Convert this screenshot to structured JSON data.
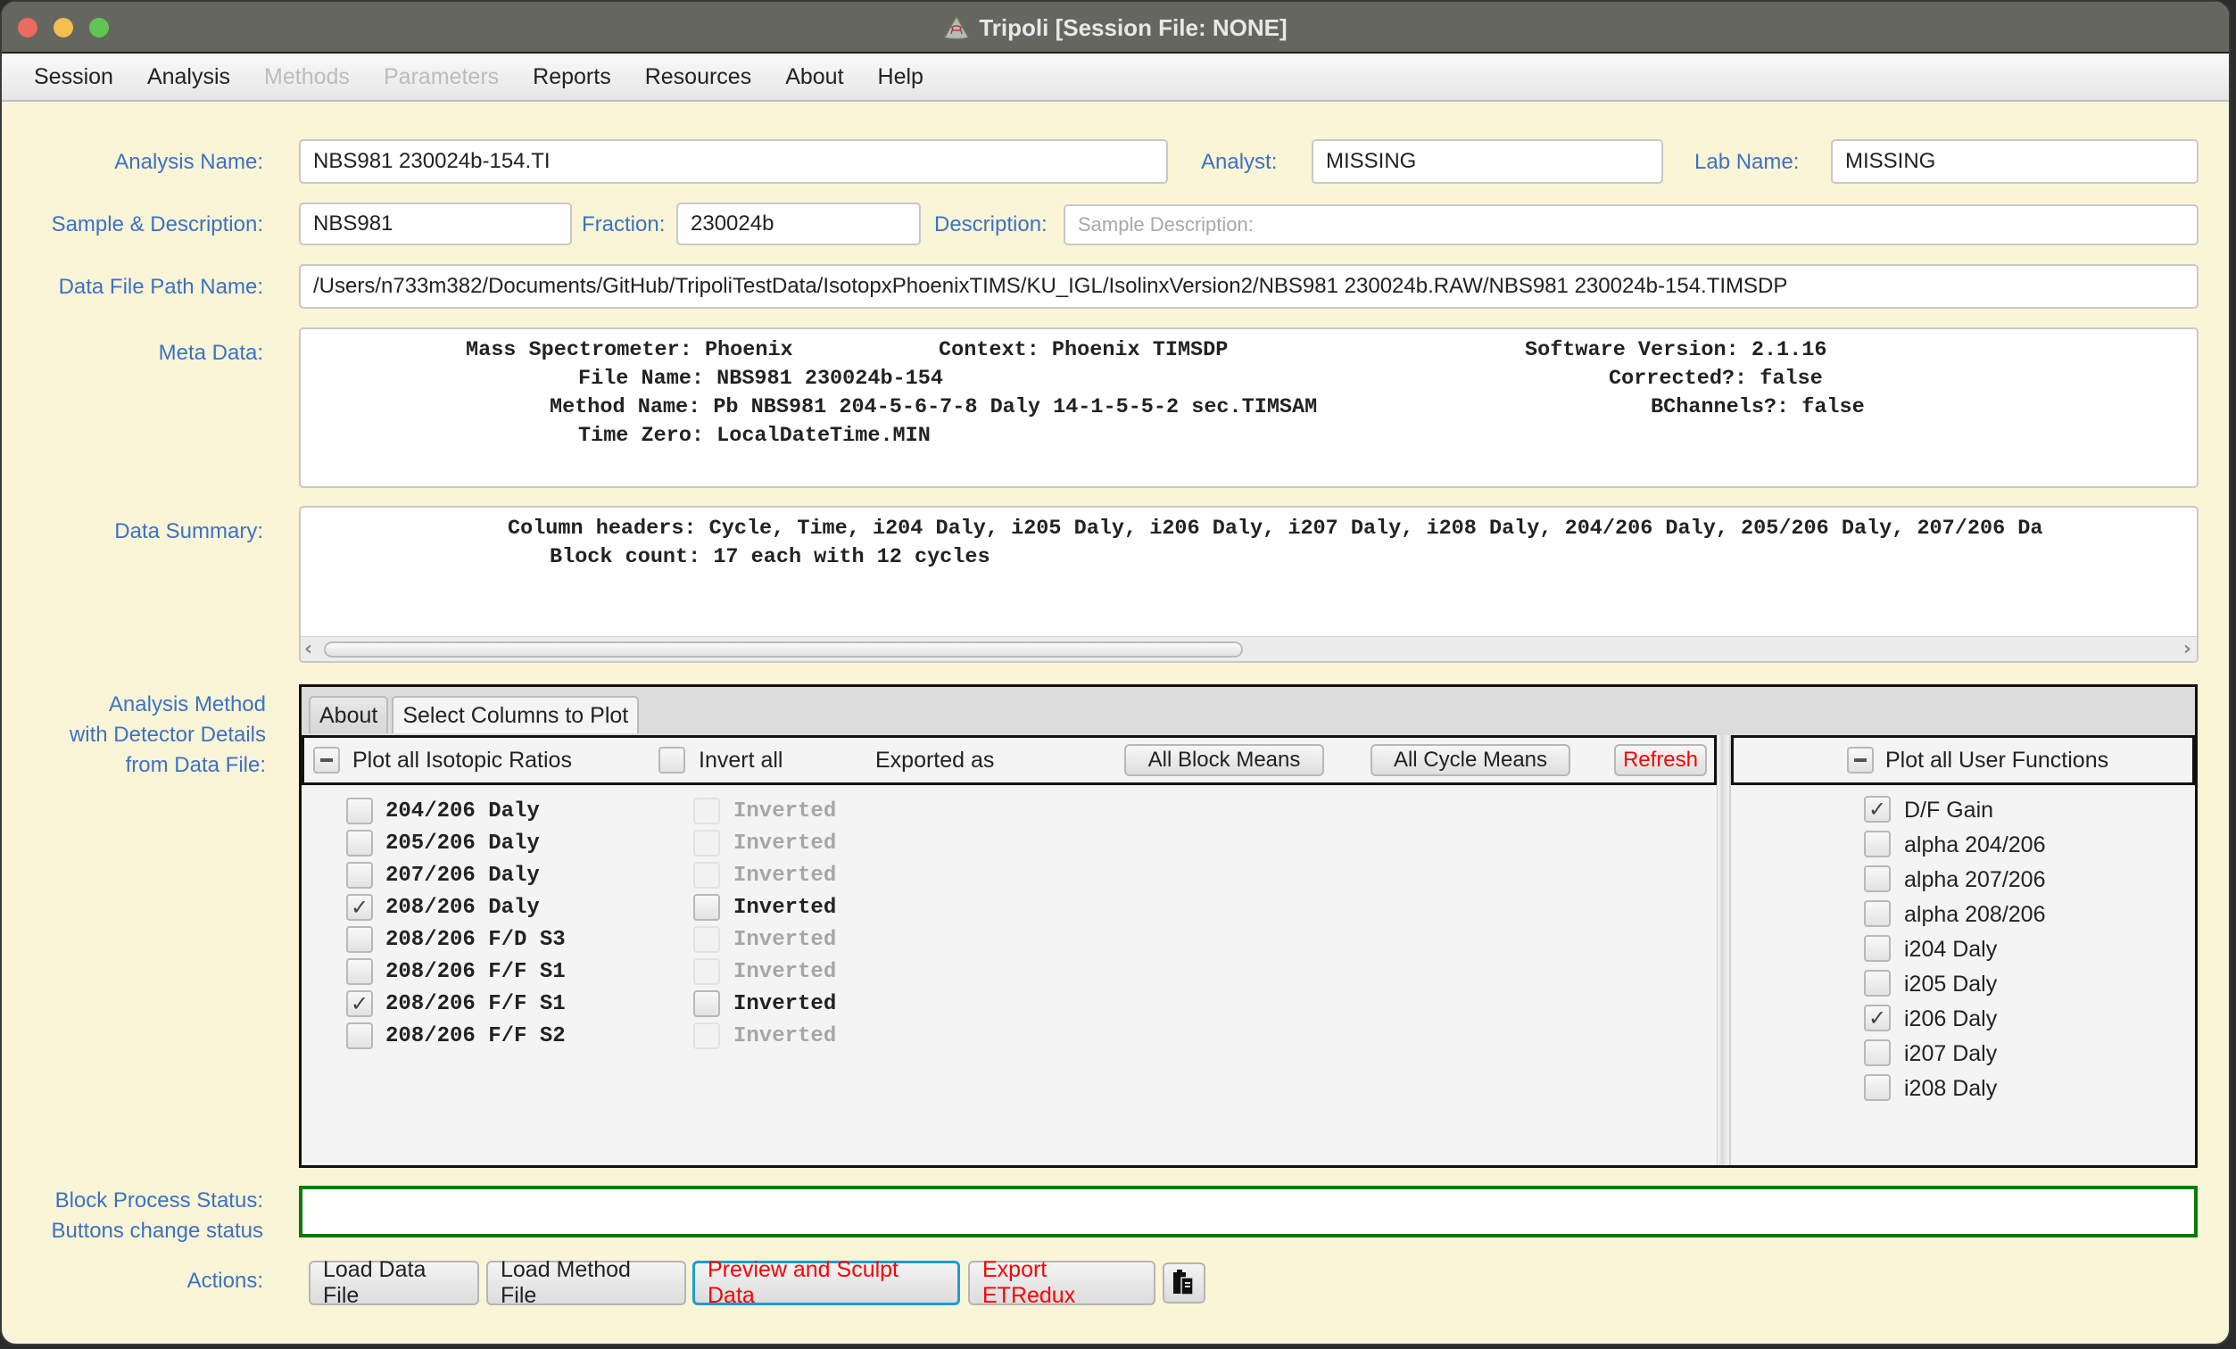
{
  "window": {
    "title": "Tripoli  [Session File: NONE]"
  },
  "menu": [
    {
      "label": "Session",
      "enabled": true
    },
    {
      "label": "Analysis",
      "enabled": true
    },
    {
      "label": "Methods",
      "enabled": false
    },
    {
      "label": "Parameters",
      "enabled": false
    },
    {
      "label": "Reports",
      "enabled": true
    },
    {
      "label": "Resources",
      "enabled": true
    },
    {
      "label": "About",
      "enabled": true
    },
    {
      "label": "Help",
      "enabled": true
    }
  ],
  "form": {
    "analysis_name_label": "Analysis Name:",
    "analysis_name": "NBS981 230024b-154.TI",
    "analyst_label": "Analyst:",
    "analyst": "MISSING",
    "lab_name_label": "Lab Name:",
    "lab_name": "MISSING",
    "sample_label": "Sample & Description:",
    "sample": "NBS981",
    "fraction_label": "Fraction:",
    "fraction": "230024b",
    "description_label": "Description:",
    "description": "",
    "description_placeholder": "Sample Description:",
    "data_file_path_label": "Data File Path Name:",
    "data_file_path": "/Users/n733m382/Documents/GitHub/TripoliTestData/IsotopxPhoenixTIMS/KU_IGL/IsolinxVersion2/NBS981 230024b.RAW/NBS981 230024b-154.TIMSDP"
  },
  "meta": {
    "label": "Meta Data:",
    "mass_spectrometer": "Mass Spectrometer: Phoenix",
    "context": "Context: Phoenix TIMSDP",
    "software_version": "Software Version: 2.1.16",
    "file_name": "File Name: NBS981 230024b-154",
    "corrected": "Corrected?: false",
    "method_name": "Method Name: Pb NBS981 204-5-6-7-8 Daly 14-1-5-5-2 sec.TIMSAM",
    "bchannels": "BChannels?: false",
    "time_zero": "Time Zero: LocalDateTime.MIN"
  },
  "summary": {
    "label": "Data Summary:",
    "column_headers": "Column headers: Cycle, Time, i204 Daly, i205 Daly, i206 Daly, i207 Daly, i208 Daly, 204/206 Daly, 205/206 Daly, 207/206 Da",
    "block_count": "Block count: 17 each with 12 cycles"
  },
  "analysis_method": {
    "label_line1": "Analysis Method",
    "label_line2": "with Detector Details",
    "label_line3": "from Data File:",
    "tabs": [
      {
        "label": "About",
        "active": false
      },
      {
        "label": "Select Columns to Plot",
        "active": true
      }
    ],
    "plot_all_ratios_label": "Plot all Isotopic Ratios",
    "invert_all_label": "Invert all",
    "exported_as_label": "Exported as",
    "all_block_means_label": "All Block Means",
    "all_cycle_means_label": "All Cycle Means",
    "refresh_label": "Refresh",
    "ratios": [
      {
        "name": "204/206 Daly",
        "checked": false,
        "inverted_label": "Inverted",
        "inverted_enabled": false
      },
      {
        "name": "205/206 Daly",
        "checked": false,
        "inverted_label": "Inverted",
        "inverted_enabled": false
      },
      {
        "name": "207/206 Daly",
        "checked": false,
        "inverted_label": "Inverted",
        "inverted_enabled": false
      },
      {
        "name": "208/206 Daly",
        "checked": true,
        "inverted_label": "Inverted",
        "inverted_enabled": true
      },
      {
        "name": "208/206 F/D S3",
        "checked": false,
        "inverted_label": "Inverted",
        "inverted_enabled": false
      },
      {
        "name": "208/206 F/F S1",
        "checked": false,
        "inverted_label": "Inverted",
        "inverted_enabled": false
      },
      {
        "name": "208/206 F/F S1",
        "checked": true,
        "inverted_label": "Inverted",
        "inverted_enabled": true
      },
      {
        "name": "208/206 F/F S2",
        "checked": false,
        "inverted_label": "Inverted",
        "inverted_enabled": false
      }
    ],
    "plot_all_user_functions_label": "Plot all User Functions",
    "user_functions": [
      {
        "name": "D/F Gain",
        "checked": true
      },
      {
        "name": "alpha 204/206",
        "checked": false
      },
      {
        "name": "alpha 207/206",
        "checked": false
      },
      {
        "name": "alpha 208/206",
        "checked": false
      },
      {
        "name": "i204 Daly",
        "checked": false
      },
      {
        "name": "i205 Daly",
        "checked": false
      },
      {
        "name": "i206 Daly",
        "checked": true
      },
      {
        "name": "i207 Daly",
        "checked": false
      },
      {
        "name": "i208 Daly",
        "checked": false
      }
    ]
  },
  "status": {
    "label_line1": "Block Process Status:",
    "label_line2": "Buttons change status",
    "value": ""
  },
  "actions": {
    "label": "Actions:",
    "load_data_file": "Load Data File",
    "load_method_file": "Load Method File",
    "preview_and_sculpt": "Preview and Sculpt Data",
    "export_etredux": "Export ETRedux",
    "clipboard_icon": "clipboard-icon"
  },
  "colors": {
    "background": "#faf5d7",
    "label_blue": "#3b72c4",
    "alert_red": "#ff0000",
    "status_green": "#0a7a0a",
    "focus_blue": "#1e9bd7"
  }
}
